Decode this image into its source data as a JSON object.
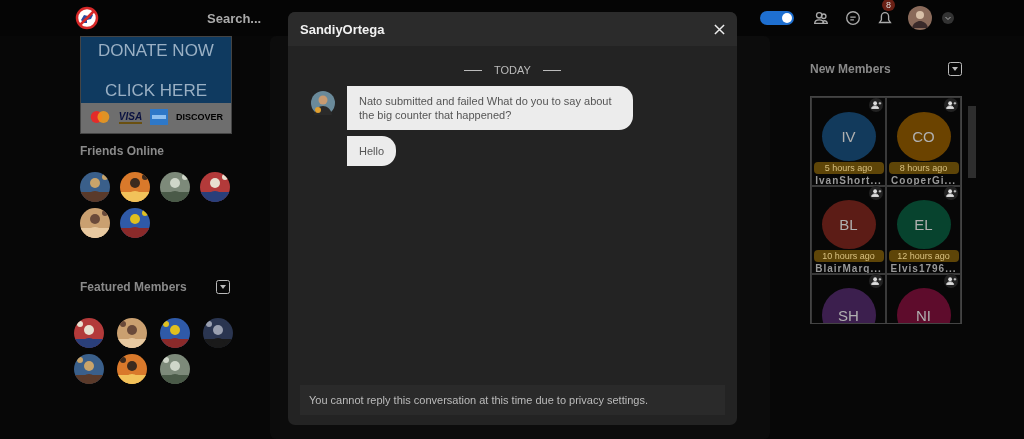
{
  "topbar": {
    "search": {
      "placeholder": "Search..."
    },
    "theme_toggle": {
      "on": true
    },
    "notification_count": "8"
  },
  "donate": {
    "headline": "DONATE NOW",
    "cta": "CLICK HERE",
    "cards": [
      "VISA",
      "DISCOVER"
    ]
  },
  "friends_online": {
    "title": "Friends Online"
  },
  "featured_members": {
    "title": "Featured Members"
  },
  "new_members": {
    "title": "New Members",
    "members": [
      {
        "initials": "IV",
        "time": "5 hours ago",
        "name": "IvanShort...",
        "color": "#123a5c"
      },
      {
        "initials": "CO",
        "time": "8 hours ago",
        "name": "CooperGi...",
        "color": "#6b4300"
      },
      {
        "initials": "BL",
        "time": "10 hours ago",
        "name": "BlairMarq...",
        "color": "#5c1c16"
      },
      {
        "initials": "EL",
        "time": "12 hours ago",
        "name": "Elvis1796...",
        "color": "#07432e"
      },
      {
        "initials": "SH",
        "color": "#3c1f4e"
      },
      {
        "initials": "NI",
        "color": "#5e0c2c"
      }
    ]
  },
  "chat": {
    "title": "SandiyOrtega",
    "date": "TODAY",
    "messages": [
      "Nato submitted and failed What do you to say about the big counter that happened?",
      "Hello"
    ],
    "notice": "You cannot reply this conversation at this time due to privacy settings."
  }
}
